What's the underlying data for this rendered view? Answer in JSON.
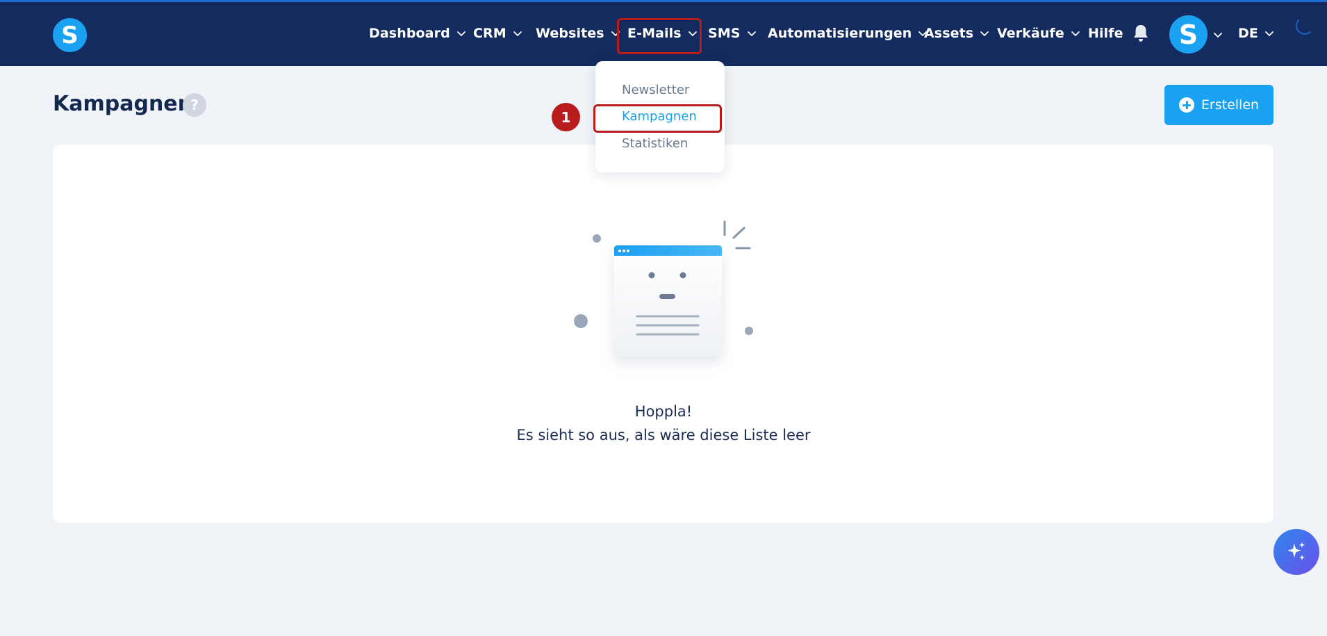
{
  "app": {
    "logo_letter": "S",
    "colors": {
      "topbar": "#132b5e",
      "accent": "#1ba1f2",
      "highlight": "#b91c1c",
      "background": "#f0f3f8"
    }
  },
  "nav": {
    "items": [
      {
        "label": "Dashboard",
        "has_dropdown": true
      },
      {
        "label": "CRM",
        "has_dropdown": true
      },
      {
        "label": "Websites",
        "has_dropdown": true
      },
      {
        "label": "E-Mails",
        "has_dropdown": true
      },
      {
        "label": "SMS",
        "has_dropdown": true
      },
      {
        "label": "Automatisierungen",
        "has_dropdown": true
      },
      {
        "label": "Assets",
        "has_dropdown": true
      },
      {
        "label": "Verkäufe",
        "has_dropdown": true
      },
      {
        "label": "Hilfe",
        "has_dropdown": false
      }
    ],
    "avatar_letter": "S",
    "language": "DE",
    "bell_icon": "bell-icon"
  },
  "dropdown": {
    "items": [
      {
        "label": "Newsletter",
        "active": false
      },
      {
        "label": "Kampagnen",
        "active": true
      },
      {
        "label": "Statistiken",
        "active": false
      }
    ]
  },
  "annotation": {
    "step_number": "1"
  },
  "page": {
    "title": "Kampagnen",
    "help_symbol": "?",
    "create_label": "Erstellen"
  },
  "empty_state": {
    "title": "Hoppla!",
    "message": "Es sieht so aus, als wäre diese Liste leer"
  }
}
